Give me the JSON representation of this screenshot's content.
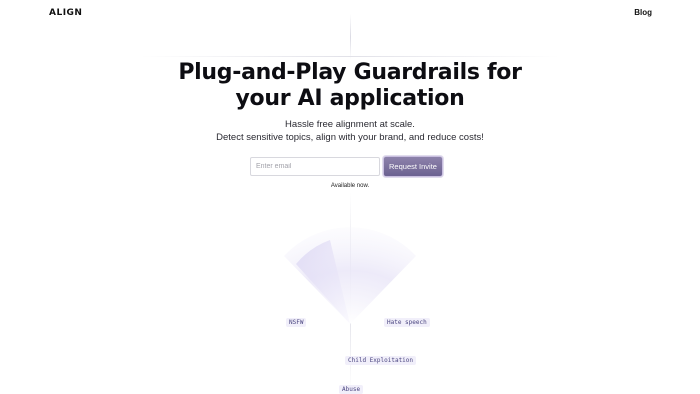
{
  "brand": {
    "logo_text": "ALIGN"
  },
  "nav": {
    "blog_label": "Blog"
  },
  "hero": {
    "title_line1": "Plug-and-Play Guardrails for",
    "title_line2": "your AI application",
    "subtitle_line1": "Hassle free alignment at scale.",
    "subtitle_line2": "Detect sensitive topics, align with your brand, and reduce costs!"
  },
  "signup": {
    "email_placeholder": "Enter email",
    "email_value": "",
    "button_label": "Request Invite",
    "availability_note": "Available now."
  },
  "categories": {
    "nsfw": "NSFW",
    "hate_speech": "Hate speech",
    "child_exploitation": "Child Exploitation",
    "abuse": "Abuse"
  },
  "colors": {
    "accent": "#7a6f9c",
    "tag_background": "#f1effa",
    "tag_text": "#4a4580"
  }
}
